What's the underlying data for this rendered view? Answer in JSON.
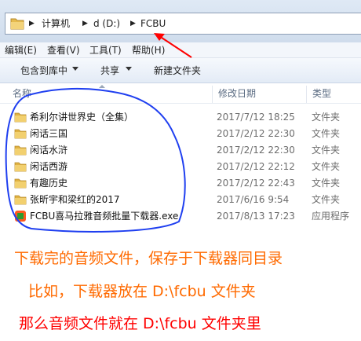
{
  "address": {
    "crumbs": [
      "计算机",
      "d (D:)",
      "FCBU"
    ]
  },
  "menu": [
    "编辑(E)",
    "查看(V)",
    "工具(T)",
    "帮助(H)"
  ],
  "toolbar": {
    "include_label": "包含到库中",
    "share_label": "共享",
    "new_folder_label": "新建文件夹"
  },
  "columns": {
    "name": "名称",
    "modified": "修改日期",
    "type": "类型"
  },
  "files": [
    {
      "icon": "folder-icon",
      "name": "希利尔讲世界史（全集）",
      "modified": "2017/7/12 18:25",
      "type": "文件夹"
    },
    {
      "icon": "folder-icon",
      "name": "闲话三国",
      "modified": "2017/2/12 22:30",
      "type": "文件夹"
    },
    {
      "icon": "folder-icon",
      "name": "闲话水浒",
      "modified": "2017/2/12 22:30",
      "type": "文件夹"
    },
    {
      "icon": "folder-icon",
      "name": "闲话西游",
      "modified": "2017/2/12 22:12",
      "type": "文件夹"
    },
    {
      "icon": "folder-icon",
      "name": "有趣历史",
      "modified": "2017/2/12 22:43",
      "type": "文件夹"
    },
    {
      "icon": "folder-icon",
      "name": "张昕宇和梁红的2017",
      "modified": "2017/6/16 9:54",
      "type": "文件夹"
    },
    {
      "icon": "app-icon",
      "name": "FCBU喜马拉雅音频批量下载器.exe",
      "modified": "2017/8/13 17:23",
      "type": "应用程序"
    }
  ],
  "annotations": {
    "line1": "下载完的音频文件，保存于下载器同目录",
    "line2": "比如，下载器放在 D:\\fcbu 文件夹",
    "line3": "那么音频文件就在 D:\\fcbu 文件夹里"
  },
  "colors": {
    "annotation_orange": "#ff6a00",
    "annotation_red": "#ff0000",
    "circle_blue": "#1f3ff0",
    "folder": "#e9c15a"
  }
}
